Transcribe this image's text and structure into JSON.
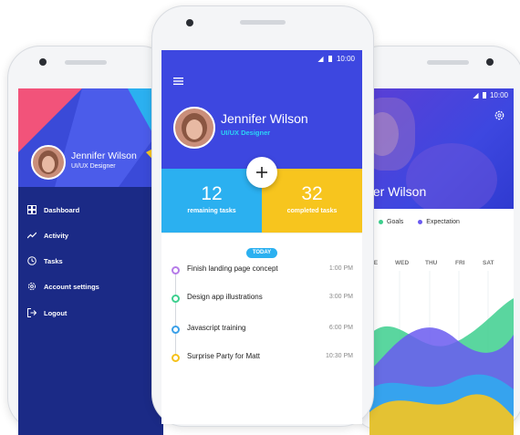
{
  "status": {
    "time": "10:00"
  },
  "user": {
    "name": "Jennifer Wilson",
    "role": "UI/UX Designer"
  },
  "drawer": {
    "items": [
      {
        "label": "Dashboard",
        "icon": "dashboard-icon"
      },
      {
        "label": "Activity",
        "icon": "trending-up-icon"
      },
      {
        "label": "Tasks",
        "icon": "clock-icon"
      },
      {
        "label": "Account settings",
        "icon": "gear-icon"
      },
      {
        "label": "Logout",
        "icon": "logout-icon"
      }
    ]
  },
  "stats": {
    "remaining_count": "12",
    "remaining_label": "remaining tasks",
    "completed_count": "32",
    "completed_label": "completed tasks"
  },
  "today_badge": "TODAY",
  "tasks": [
    {
      "title": "Finish landing page concept",
      "time": "1:00 PM",
      "color": "#b57be8"
    },
    {
      "title": "Design app illustrations",
      "time": "3:00 PM",
      "color": "#3dcf8e"
    },
    {
      "title": "Javascript training",
      "time": "6:00 PM",
      "color": "#3aa0e8"
    },
    {
      "title": "Surprise Party for Matt",
      "time": "10:30 PM",
      "color": "#f5c11b"
    }
  ],
  "profile": {
    "name_visible": "fer Wilson",
    "legend": [
      {
        "label": "Goals",
        "color": "#3dcf8e"
      },
      {
        "label": "Expectation",
        "color": "#6a5af0"
      }
    ],
    "days": [
      "UE",
      "WED",
      "THU",
      "FRI",
      "SAT"
    ]
  },
  "colors": {
    "primary": "#3d47e0",
    "accent_blue": "#2bb0f0",
    "accent_yellow": "#f7c51e",
    "drawer_bg": "#1b2a86"
  }
}
